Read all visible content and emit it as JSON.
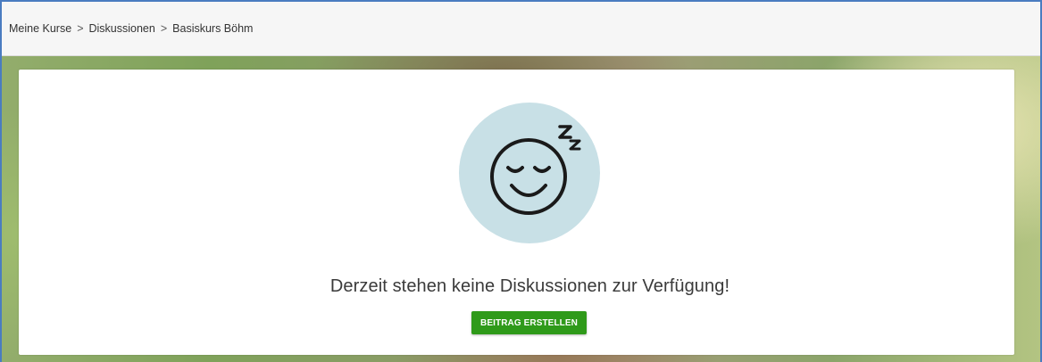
{
  "breadcrumb": {
    "items": [
      "Meine Kurse",
      "Diskussionen",
      "Basiskurs Böhm"
    ],
    "separator": ">"
  },
  "empty_state": {
    "icon": "sleeping-smiley-icon",
    "sleep_text": "Z z",
    "message": "Derzeit stehen keine Diskussionen zur Verfügung!",
    "button_label": "BEITRAG ERSTELLEN"
  },
  "colors": {
    "accent_button": "#2f9a1a",
    "icon_circle": "#c8e0e6",
    "window_border": "#4a7cc0"
  }
}
